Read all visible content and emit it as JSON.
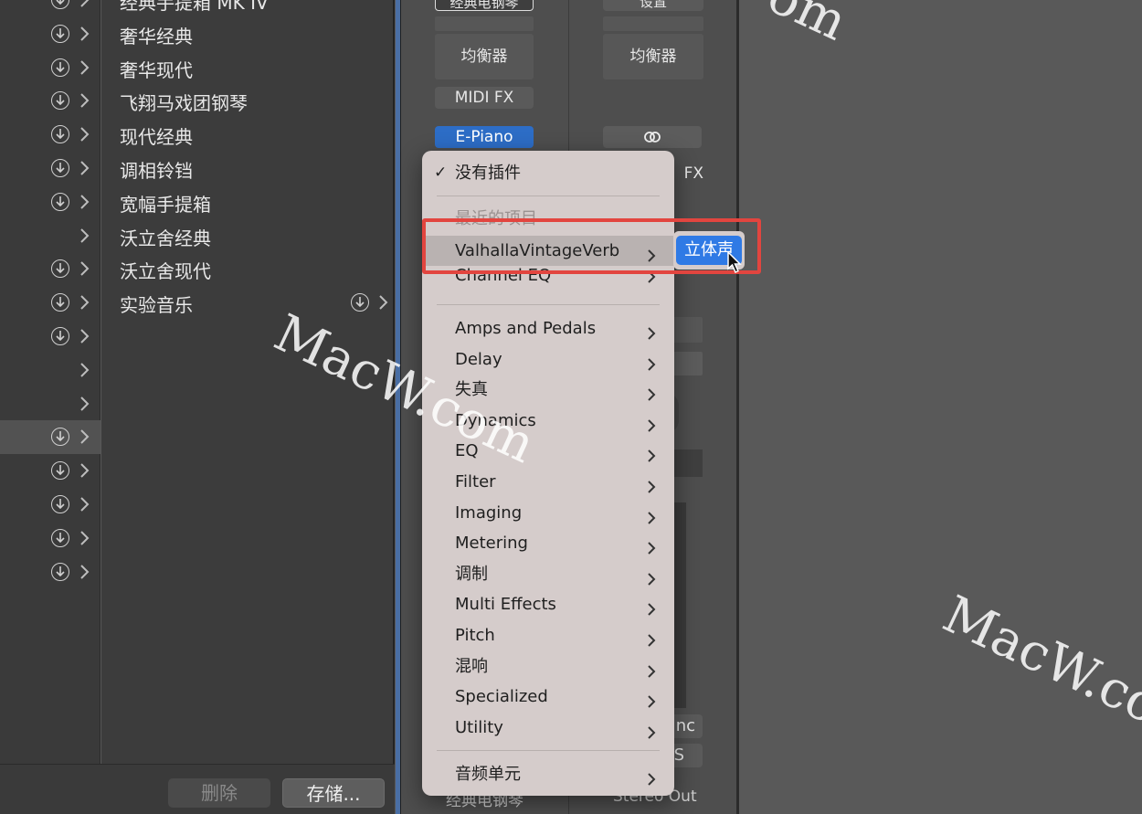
{
  "library": {
    "presets": [
      {
        "label": "经典手提箱 MK IV",
        "download": true
      },
      {
        "label": "奢华经典",
        "download": true
      },
      {
        "label": "奢华现代",
        "download": true
      },
      {
        "label": "飞翔马戏团钢琴",
        "download": true
      },
      {
        "label": "现代经典",
        "download": true
      },
      {
        "label": "调相铃铛",
        "download": true
      },
      {
        "label": "宽幅手提箱",
        "download": true
      },
      {
        "label": "沃立舍经典",
        "download": false
      },
      {
        "label": "沃立舍现代",
        "download": true
      },
      {
        "label": "实验音乐",
        "download": true
      }
    ],
    "delete_label": "删除",
    "save_label": "存储..."
  },
  "strips": {
    "left": {
      "top_slot": "经典电钢琴",
      "eq_label": "均衡器",
      "midi_fx_label": "MIDI FX",
      "instrument_label": "E-Piano",
      "name": "经典电钢琴"
    },
    "right": {
      "top_slot": "设置",
      "eq_label": "均衡器",
      "fx_partial": "FX",
      "inc_partial": "nc",
      "s_partial": "S",
      "name": "Stereo Out"
    }
  },
  "menu": {
    "no_plugin": "没有插件",
    "check": "✓",
    "recent_header": "最近的项目",
    "items_recent": [
      "ValhallaVintageVerb",
      "Channel EQ"
    ],
    "items_categories": [
      "Amps and Pedals",
      "Delay",
      "失真",
      "Dynamics",
      "EQ",
      "Filter",
      "Imaging",
      "Metering",
      "调制",
      "Multi Effects",
      "Pitch",
      "混响",
      "Specialized",
      "Utility"
    ],
    "audio_units": "音频单元",
    "submenu_stereo": "立体声"
  },
  "watermark": "MacW.com",
  "colors": {
    "accent_blue": "#2f7ae5",
    "highlight_red": "#e2453f",
    "menu_bg": "#d5cccb"
  }
}
